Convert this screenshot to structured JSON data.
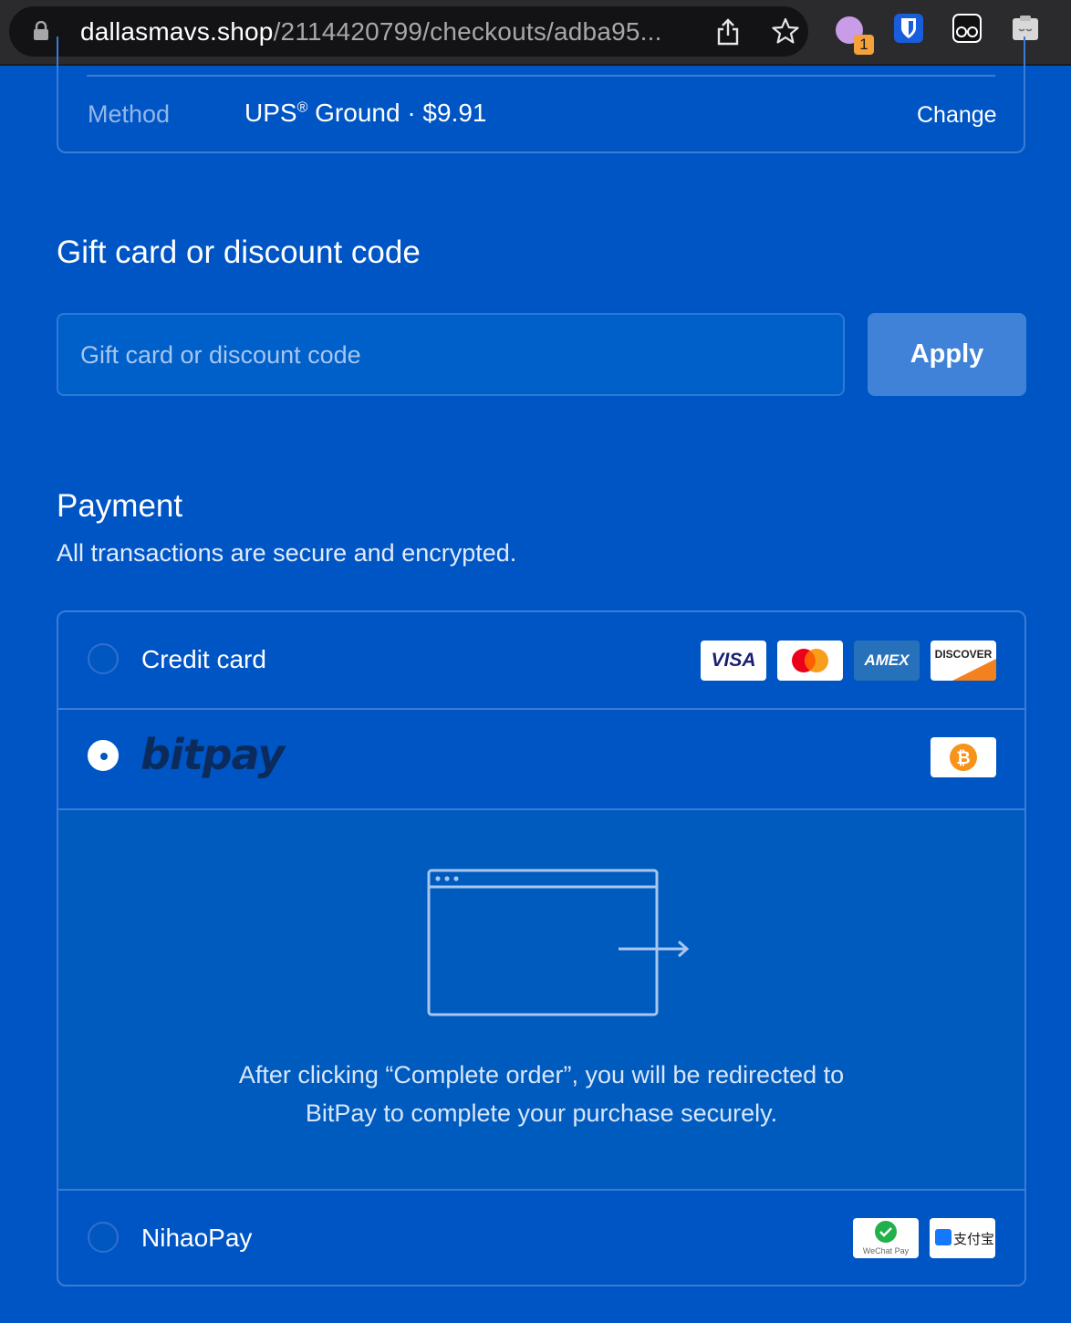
{
  "browser": {
    "url_host": "dallasmavs.shop",
    "url_path": "/2114420799/checkouts/adba95...",
    "extension_badge": "1",
    "icons": [
      "lock-icon",
      "share-icon",
      "star-icon",
      "profile-extension-icon",
      "bitwarden-icon",
      "glasses-extension-icon",
      "cloud-extension-icon"
    ]
  },
  "shipping": {
    "method_label": "Method",
    "method_carrier": "UPS",
    "method_trademark": "®",
    "method_rest": " Ground · $9.91",
    "change_label": "Change"
  },
  "gift": {
    "title": "Gift card or discount code",
    "placeholder": "Gift card or discount code",
    "apply_label": "Apply"
  },
  "payment": {
    "title": "Payment",
    "subtitle": "All transactions are secure and encrypted.",
    "options": [
      {
        "label": "Credit card",
        "selected": false,
        "logos": [
          "VISA",
          "AMEX",
          "DISCOVER"
        ]
      },
      {
        "label": "bitpay",
        "selected": true
      },
      {
        "label": "NihaoPay",
        "selected": false
      }
    ],
    "redirect_line1": "After clicking “Complete order”, you will be redirected to",
    "redirect_line2": "BitPay to complete your purchase securely.",
    "wechat_label": "WeChat Pay",
    "alipay_label": "支付宝"
  },
  "colors": {
    "page_bg": "#0055c4",
    "border": "#3b7bd6",
    "apply_bg": "#3f82d7"
  }
}
